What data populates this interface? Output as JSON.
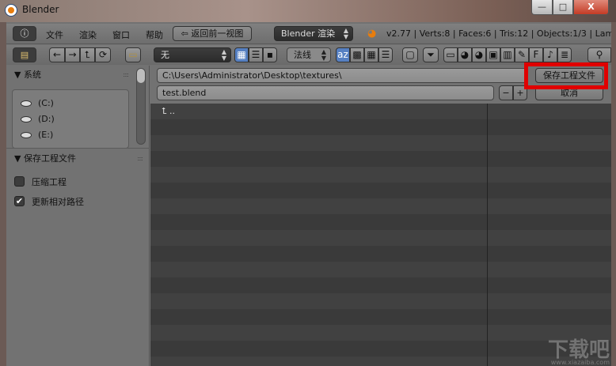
{
  "window": {
    "title": "Blender",
    "min": "—",
    "max": "□",
    "close": "X"
  },
  "menu": {
    "items": [
      "文件",
      "渲染",
      "窗口",
      "帮助"
    ],
    "back_button": "返回前一视图",
    "engine": "Blender 渲染",
    "stats": "v2.77 | Verts:8 | Faces:6 | Tris:12 | Objects:1/3 | Lamps:0"
  },
  "toolbar": {
    "recent_filter": "无",
    "display_mode": "法线",
    "nav": [
      "←",
      "→",
      "⮤",
      "⟳"
    ]
  },
  "left": {
    "system_header": "系统",
    "drives": [
      "(C:)",
      "(D:)",
      "(E:)"
    ],
    "save_header": "保存工程文件",
    "options": [
      {
        "label": "压缩工程",
        "checked": false
      },
      {
        "label": "更新相对路径",
        "checked": true
      }
    ]
  },
  "main": {
    "path": "C:\\Users\\Administrator\\Desktop\\textures\\",
    "filename": "test.blend",
    "save_button": "保存工程文件",
    "cancel_button": "取消",
    "minus": "−",
    "plus": "+",
    "parent_entry": ".."
  },
  "watermark": {
    "text": "下载吧",
    "url": "www.xiazaiba.com"
  },
  "colors": {
    "highlight": "#e00000",
    "accent_blue": "#5680c2"
  }
}
